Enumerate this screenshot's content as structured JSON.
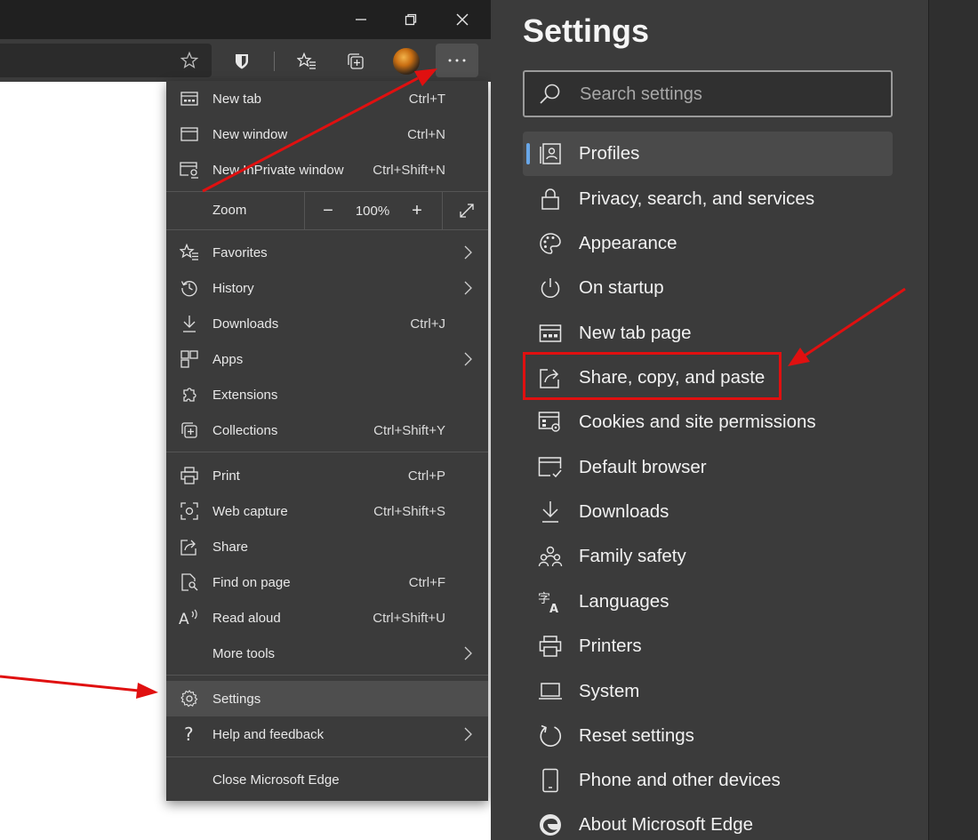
{
  "menu": {
    "items": [
      {
        "label": "New tab",
        "shortcut": "Ctrl+T",
        "icon": "new-tab-icon"
      },
      {
        "label": "New window",
        "shortcut": "Ctrl+N",
        "icon": "new-window-icon"
      },
      {
        "label": "New InPrivate window",
        "shortcut": "Ctrl+Shift+N",
        "icon": "inprivate-icon"
      },
      {
        "label": "Favorites",
        "shortcut": "",
        "icon": "favorites-icon"
      },
      {
        "label": "History",
        "shortcut": "",
        "icon": "history-icon"
      },
      {
        "label": "Downloads",
        "shortcut": "Ctrl+J",
        "icon": "download-icon"
      },
      {
        "label": "Apps",
        "shortcut": "",
        "icon": "apps-icon"
      },
      {
        "label": "Extensions",
        "shortcut": "",
        "icon": "extensions-icon"
      },
      {
        "label": "Collections",
        "shortcut": "Ctrl+Shift+Y",
        "icon": "collections-icon"
      },
      {
        "label": "Print",
        "shortcut": "Ctrl+P",
        "icon": "print-icon"
      },
      {
        "label": "Web capture",
        "shortcut": "Ctrl+Shift+S",
        "icon": "web-capture-icon"
      },
      {
        "label": "Share",
        "shortcut": "",
        "icon": "share-icon"
      },
      {
        "label": "Find on page",
        "shortcut": "Ctrl+F",
        "icon": "find-icon"
      },
      {
        "label": "Read aloud",
        "shortcut": "Ctrl+Shift+U",
        "icon": "read-aloud-icon"
      },
      {
        "label": "More tools",
        "shortcut": "",
        "icon": "none"
      },
      {
        "label": "Settings",
        "shortcut": "",
        "icon": "gear-icon"
      },
      {
        "label": "Help and feedback",
        "shortcut": "",
        "icon": "help-icon"
      },
      {
        "label": "Close Microsoft Edge",
        "shortcut": "",
        "icon": "none"
      }
    ],
    "zoom": {
      "label": "Zoom",
      "value": "100%",
      "minus": "−",
      "plus": "+"
    }
  },
  "settings": {
    "title": "Settings",
    "search_placeholder": "Search settings",
    "items": [
      {
        "label": "Profiles",
        "icon": "profile-icon"
      },
      {
        "label": "Privacy, search, and services",
        "icon": "lock-icon"
      },
      {
        "label": "Appearance",
        "icon": "palette-icon"
      },
      {
        "label": "On startup",
        "icon": "power-icon"
      },
      {
        "label": "New tab page",
        "icon": "new-tab-page-icon"
      },
      {
        "label": "Share, copy, and paste",
        "icon": "share-icon"
      },
      {
        "label": "Cookies and site permissions",
        "icon": "cookies-icon"
      },
      {
        "label": "Default browser",
        "icon": "default-browser-icon"
      },
      {
        "label": "Downloads",
        "icon": "download-icon"
      },
      {
        "label": "Family safety",
        "icon": "family-icon"
      },
      {
        "label": "Languages",
        "icon": "languages-icon"
      },
      {
        "label": "Printers",
        "icon": "printer-icon"
      },
      {
        "label": "System",
        "icon": "laptop-icon"
      },
      {
        "label": "Reset settings",
        "icon": "reset-icon"
      },
      {
        "label": "Phone and other devices",
        "icon": "phone-icon"
      },
      {
        "label": "About Microsoft Edge",
        "icon": "edge-logo-icon"
      }
    ]
  },
  "colors": {
    "highlight_box": "#e01010",
    "arrow": "#e01010",
    "accent": "#69a7e8"
  }
}
